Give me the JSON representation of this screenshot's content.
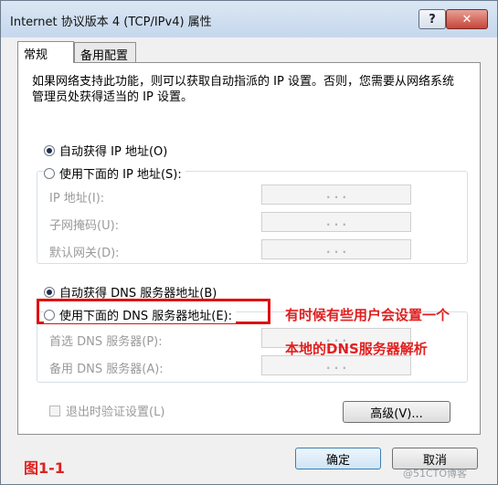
{
  "window": {
    "title": "Internet 协议版本 4 (TCP/IPv4) 属性",
    "help_label": "?",
    "close_label": "✕"
  },
  "tabs": [
    {
      "label": "常规",
      "active": true
    },
    {
      "label": "备用配置",
      "active": false
    }
  ],
  "description": "如果网络支持此功能，则可以获取自动指派的 IP 设置。否则，您需要从网络系统管理员处获得适当的 IP 设置。",
  "ip_section": {
    "auto_label": "自动获得 IP 地址(O)",
    "manual_label": "使用下面的 IP 地址(S):",
    "auto_selected": true,
    "fields": [
      {
        "label": "IP 地址(I):",
        "value": ". . ."
      },
      {
        "label": "子网掩码(U):",
        "value": ". . ."
      },
      {
        "label": "默认网关(D):",
        "value": ". . ."
      }
    ]
  },
  "dns_section": {
    "auto_label": "自动获得 DNS 服务器地址(B)",
    "manual_label": "使用下面的 DNS 服务器地址(E):",
    "auto_selected": true,
    "fields": [
      {
        "label": "首选 DNS 服务器(P):",
        "value": ". . ."
      },
      {
        "label": "备用 DNS 服务器(A):",
        "value": ". . ."
      }
    ]
  },
  "validate_label": "退出时验证设置(L)",
  "advanced_label": "高级(V)...",
  "ok_label": "确定",
  "cancel_label": "取消",
  "annotation": {
    "line1": "有时候有些用户会设置一个",
    "line2": "本地的DNS服务器解析",
    "figure": "图1-1",
    "color": "#e02020"
  },
  "watermark": "@51CTO博客"
}
